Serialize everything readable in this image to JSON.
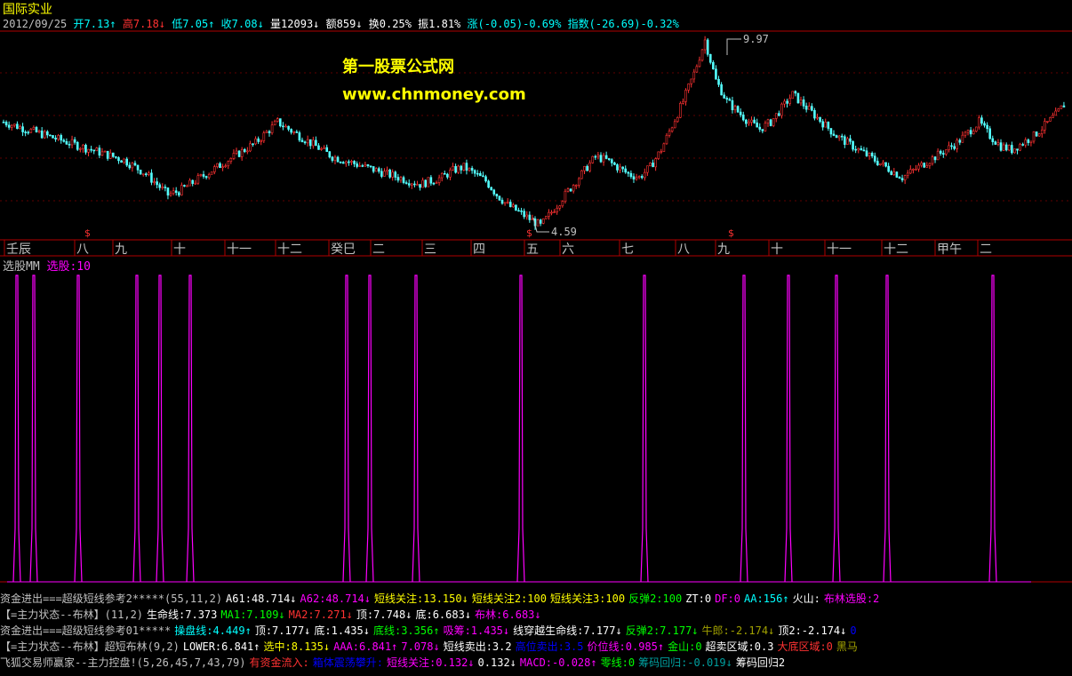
{
  "stock": {
    "name": "国际实业",
    "date": "2012/09/25",
    "open_label": "开",
    "open": "7.13",
    "high_label": "高",
    "high": "7.18",
    "low_label": "低",
    "low": "7.05",
    "close_label": "收",
    "close": "7.08",
    "volume": "量12093",
    "amount": "额859",
    "turnover": "换0.25%",
    "amplitude": "振1.81%",
    "change": "涨(-0.05)-0.69%",
    "index": "指数(-26.69)-0.32%"
  },
  "watermark": {
    "line1": "第一股票公式网",
    "line2": "www.chnmoney.com"
  },
  "price_marks": {
    "max": "9.97",
    "min": "4.59"
  },
  "time_axis": [
    "壬辰",
    "八",
    "九",
    "十",
    "十一",
    "十二",
    "癸巳",
    "二",
    "三",
    "四",
    "五",
    "六",
    "七",
    "八",
    "九",
    "十",
    "十一",
    "十二",
    "甲午",
    "二"
  ],
  "indicator": {
    "name": "选股MM",
    "value": "选股:10"
  },
  "colors": {
    "up": "#ff3232",
    "down": "#54ffff",
    "magenta": "#ff00ff",
    "yellow": "#ffff00",
    "axis": "#b00000",
    "bg": "#000000"
  },
  "chart_data": {
    "type": "candlestick",
    "close_series": [
      7.6,
      7.5,
      7.4,
      7.3,
      7.2,
      7.1,
      7.0,
      6.9,
      6.8,
      6.7,
      6.6,
      6.5,
      6.3,
      6.1,
      5.8,
      5.5,
      5.6,
      5.8,
      6.0,
      6.2,
      6.4,
      6.6,
      6.8,
      7.0,
      7.3,
      7.6,
      7.4,
      7.2,
      7.0,
      6.8,
      6.6,
      6.5,
      6.4,
      6.3,
      6.2,
      6.1,
      6.0,
      5.9,
      5.8,
      5.9,
      6.0,
      6.2,
      6.3,
      6.1,
      5.9,
      5.5,
      5.2,
      5.0,
      4.8,
      4.6,
      5.0,
      5.4,
      5.8,
      6.2,
      6.6,
      6.5,
      6.3,
      6.1,
      6.0,
      6.3,
      6.8,
      7.5,
      8.2,
      9.0,
      9.97,
      8.8,
      8.2,
      7.9,
      7.6,
      7.4,
      7.6,
      8.0,
      8.4,
      8.1,
      7.8,
      7.5,
      7.2,
      7.0,
      6.8,
      6.6,
      6.4,
      6.2,
      6.0,
      6.2,
      6.4,
      6.6,
      6.8,
      7.0,
      7.3,
      7.6,
      7.2,
      6.9,
      6.8,
      7.0,
      7.2,
      7.5,
      7.8,
      8.2
    ],
    "signal_count": 10,
    "signal_positions": [
      19,
      38,
      88,
      154,
      180,
      214,
      390,
      416,
      468,
      586,
      725,
      837,
      887,
      941,
      998,
      1117
    ]
  },
  "bottom_lines": {
    "line1": [
      {
        "t": "资金进出===超级短线参考2*****(55,11,2)",
        "c": "#c0c0c0"
      },
      {
        "t": "A61:48.714↓",
        "c": "#ffffff"
      },
      {
        "t": "A62:48.714↓",
        "c": "#ff00ff"
      },
      {
        "t": "短线关注:13.150↓",
        "c": "#ffff00"
      },
      {
        "t": "短线关注2:100",
        "c": "#ffff00"
      },
      {
        "t": "短线关注3:100",
        "c": "#ffff00"
      },
      {
        "t": "反弹2:100",
        "c": "#00ff00"
      },
      {
        "t": "ZT:0",
        "c": "#ffffff"
      },
      {
        "t": "DF:0",
        "c": "#ff00ff"
      },
      {
        "t": "AA:156↑",
        "c": "#00ffff"
      },
      {
        "t": "火山:",
        "c": "#ffffff"
      },
      {
        "t": "布林选股:2",
        "c": "#ff00ff"
      }
    ],
    "line2": [
      {
        "t": "【=主力状态--布林】(11,2)",
        "c": "#c0c0c0"
      },
      {
        "t": "生命线:7.373",
        "c": "#ffffff"
      },
      {
        "t": "MA1:7.109↓",
        "c": "#00ff00"
      },
      {
        "t": "MA2:7.271↓",
        "c": "#ff3232"
      },
      {
        "t": "顶:7.748↓",
        "c": "#ffffff"
      },
      {
        "t": "底:6.683↓",
        "c": "#ffffff"
      },
      {
        "t": "布林:6.683↓",
        "c": "#ff00ff"
      }
    ],
    "line3": [
      {
        "t": "资金进出===超级短线参考01*****",
        "c": "#c0c0c0"
      },
      {
        "t": "操盘线:4.449↑",
        "c": "#00ffff"
      },
      {
        "t": "顶:7.177↓",
        "c": "#ffffff"
      },
      {
        "t": "底:1.435↓",
        "c": "#ffffff"
      },
      {
        "t": "底线:3.356↑",
        "c": "#00ff00"
      },
      {
        "t": "吸筹:1.435↓",
        "c": "#ff00ff"
      },
      {
        "t": "线穿越生命线:7.177↓",
        "c": "#ffffff"
      },
      {
        "t": "反弹2:7.177↓",
        "c": "#00ff00"
      },
      {
        "t": "牛郎:-2.174↓",
        "c": "#a0a000"
      },
      {
        "t": "顶2:-2.174↓",
        "c": "#ffffff"
      },
      {
        "t": "0",
        "c": "#0000ff"
      }
    ],
    "line4": [
      {
        "t": "【=主力状态--布林】超短布林(9,2)",
        "c": "#c0c0c0"
      },
      {
        "t": "LOWER:6.841↑",
        "c": "#ffffff"
      },
      {
        "t": "选中:8.135↓",
        "c": "#ffff00"
      },
      {
        "t": "AAA:6.841↑",
        "c": "#ff00ff"
      },
      {
        "t": "7.078↓",
        "c": "#ff00ff"
      },
      {
        "t": "短线卖出:3.2",
        "c": "#ffffff"
      },
      {
        "t": "高位卖出:3.5",
        "c": "#0000ff"
      },
      {
        "t": "价位线:0.985↑",
        "c": "#ff00ff"
      },
      {
        "t": "金山:0",
        "c": "#00ff00"
      },
      {
        "t": "超卖区域:0.3",
        "c": "#ffffff"
      },
      {
        "t": "大底区域:0",
        "c": "#ff3232"
      },
      {
        "t": "黑马",
        "c": "#a0a000"
      }
    ],
    "line5": [
      {
        "t": "飞狐交易师赢家--主力控盘!(5,26,45,7,43,79)",
        "c": "#c0c0c0"
      },
      {
        "t": "有资金流入:",
        "c": "#ff3232"
      },
      {
        "t": "箱体震荡攀升:",
        "c": "#0000ff"
      },
      {
        "t": "短线关注:0.132↓",
        "c": "#ff00ff"
      },
      {
        "t": "0.132↓",
        "c": "#ffffff"
      },
      {
        "t": "MACD:-0.028↑",
        "c": "#ff00ff"
      },
      {
        "t": "零线:0",
        "c": "#00ff00"
      },
      {
        "t": "筹码回归:-0.019↓",
        "c": "#00a0a0"
      },
      {
        "t": "筹码回归2",
        "c": "#ffffff"
      }
    ]
  }
}
